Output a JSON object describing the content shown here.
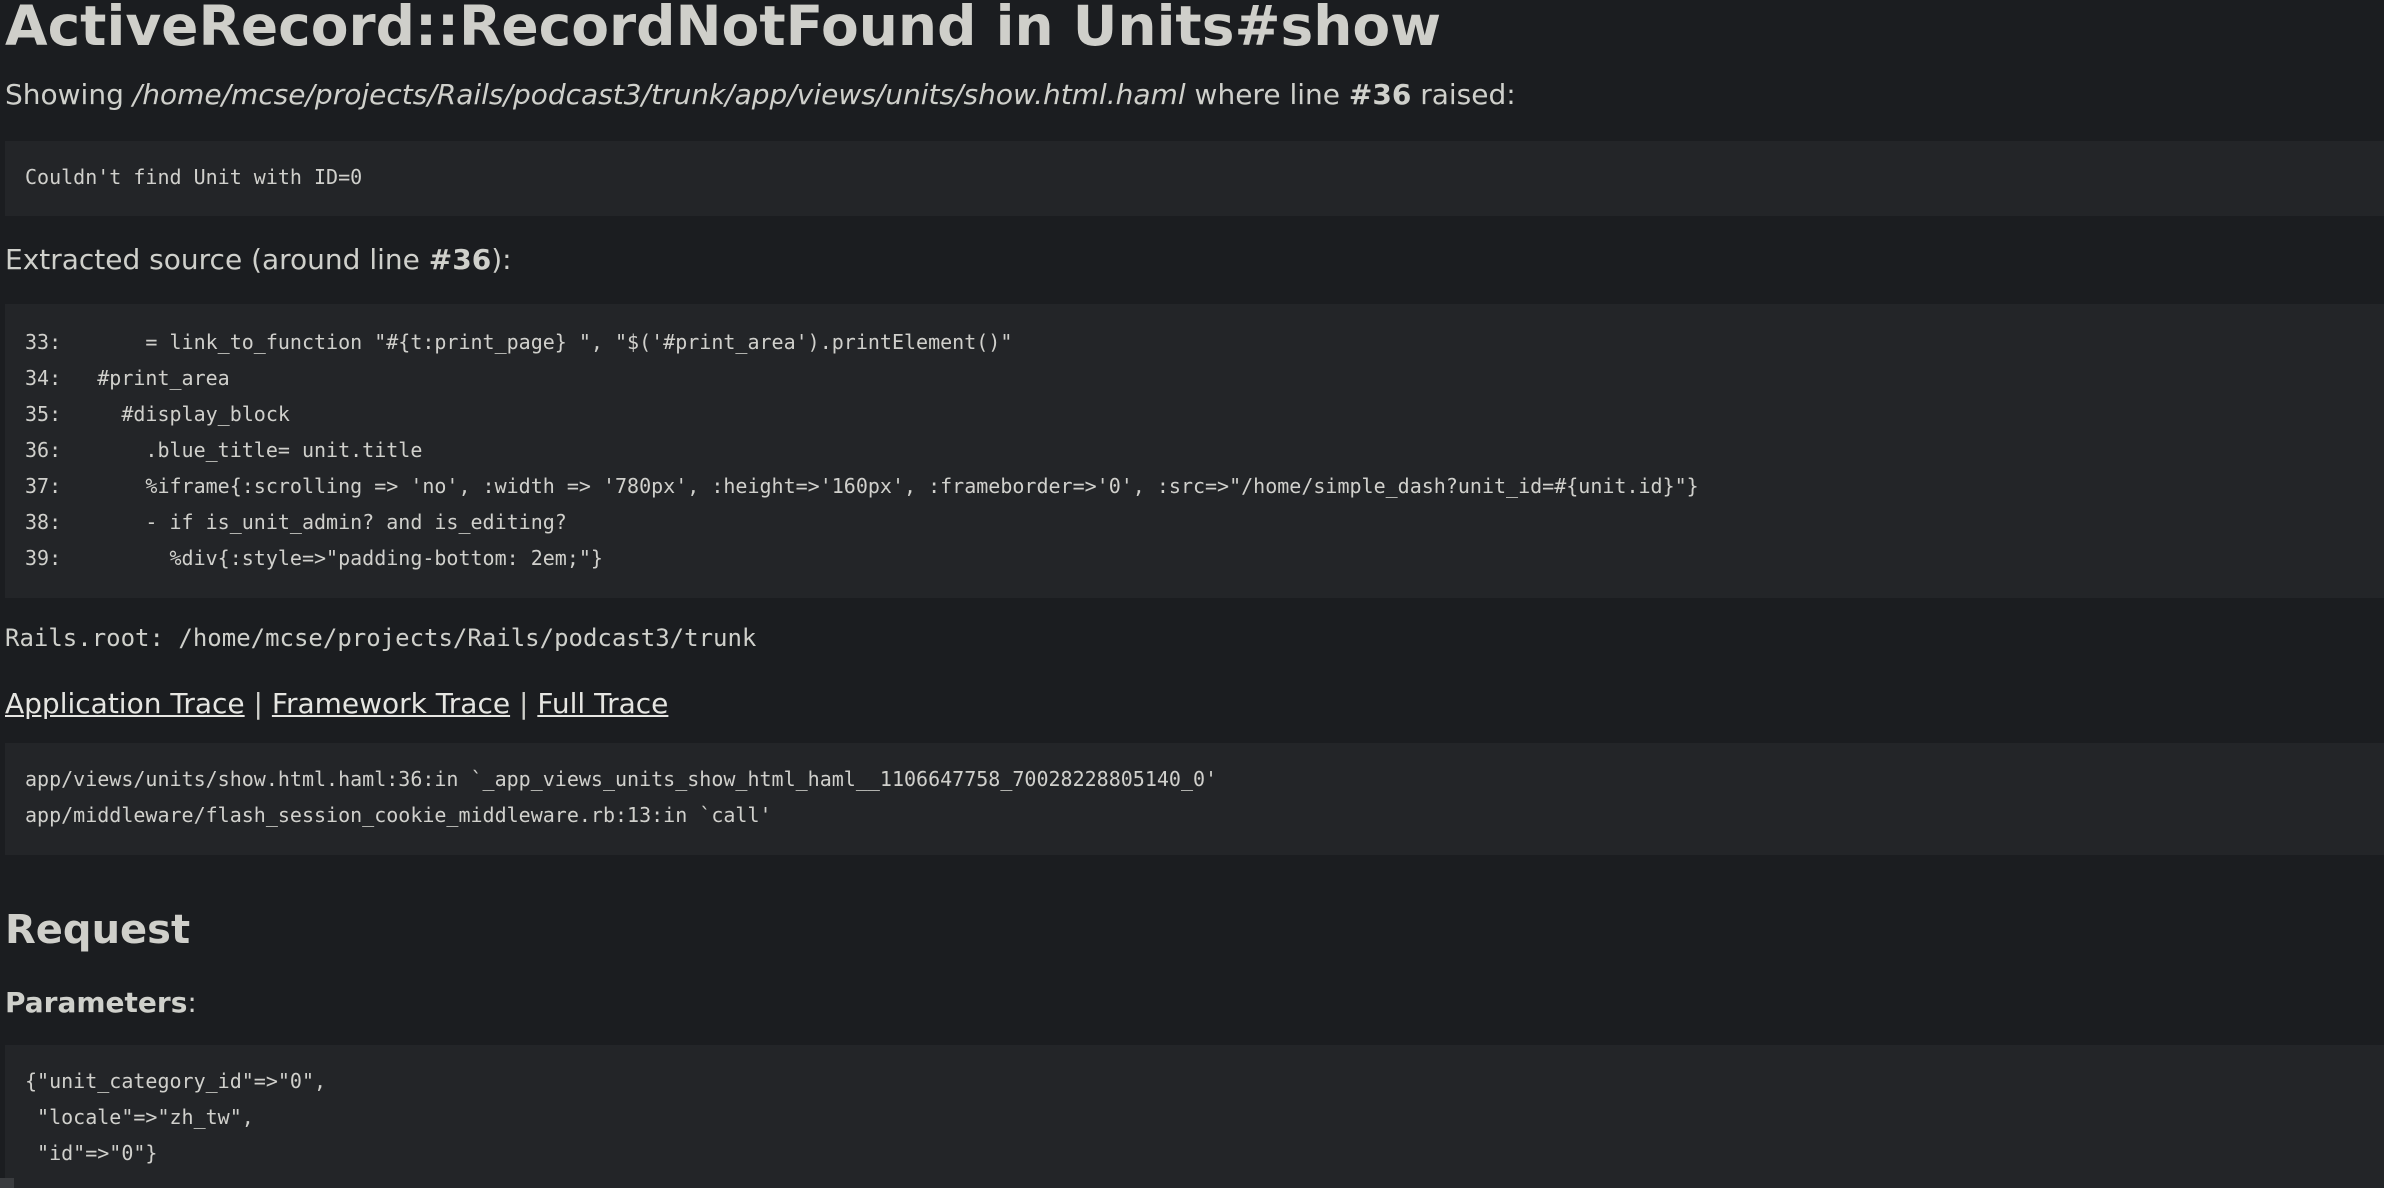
{
  "error": {
    "title": "ActiveRecord::RecordNotFound in Units#show",
    "showing_prefix": "Showing",
    "template_path": "/home/mcse/projects/Rails/podcast3/trunk/app/views/units/show.html.haml",
    "where_line_text": "where line",
    "line_number": "#36",
    "raised_text": "raised:",
    "message": "Couldn't find Unit with ID=0"
  },
  "source": {
    "label_prefix": "Extracted source (around line",
    "label_line": "#36",
    "label_suffix": "):",
    "lines": [
      "33:       = link_to_function \"#{t:print_page} \", \"$('#print_area').printElement()\"",
      "34:   #print_area",
      "35:     #display_block",
      "36:       .blue_title= unit.title",
      "37:       %iframe{:scrolling => 'no', :width => '780px', :height=>'160px', :frameborder=>'0', :src=>\"/home/simple_dash?unit_id=#{unit.id}\"}",
      "38:       - if is_unit_admin? and is_editing?",
      "39:         %div{:style=>\"padding-bottom: 2em;\"}"
    ]
  },
  "rails_root": "Rails.root: /home/mcse/projects/Rails/podcast3/trunk",
  "trace": {
    "application_label": "Application Trace",
    "framework_label": "Framework Trace",
    "full_label": "Full Trace",
    "separator": "|",
    "lines": [
      "app/views/units/show.html.haml:36:in `_app_views_units_show_html_haml__1106647758_70028228805140_0'",
      "app/middleware/flash_session_cookie_middleware.rb:13:in `call'"
    ]
  },
  "request": {
    "heading": "Request",
    "params_label": "Parameters",
    "params_colon": ":",
    "params_lines": [
      "{\"unit_category_id\"=>\"0\",",
      " \"locale\"=>\"zh_tw\",",
      " \"id\"=>\"0\"}"
    ]
  },
  "colors": {
    "background": "#1b1d20",
    "panel": "#232528",
    "text": "#cfd0cb"
  }
}
